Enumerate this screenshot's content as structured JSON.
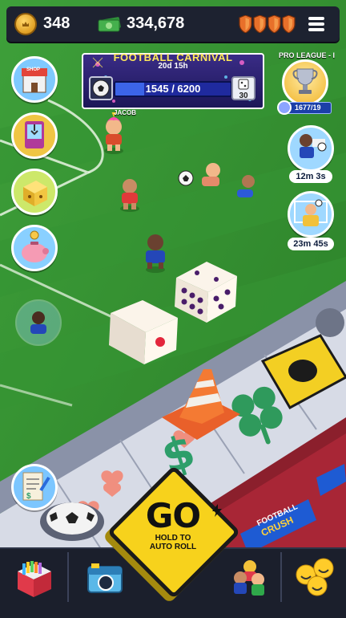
{
  "topbar": {
    "coins": "348",
    "cash": "334,678",
    "shields": 4
  },
  "event": {
    "title": "FOOTBALL CARNIVAL",
    "timer": "20d 15h",
    "progress_text": "1545 / 6200",
    "progress_fraction": 0.249,
    "dice_count": "30"
  },
  "league": {
    "title": "PRO LEAGUE - I",
    "progress_text": "1677/19"
  },
  "side_left": {
    "shop_label": "SHOP"
  },
  "side_right": {
    "timer_1": "12m 3s",
    "timer_2": "23m 45s"
  },
  "players": {
    "name_tag": "JACOB"
  },
  "board": {
    "brand_top": "FOOTBALL",
    "brand_bottom": "CRUSH"
  },
  "go_button": {
    "label": "GO",
    "subtitle_line1": "HOLD TO",
    "subtitle_line2": "AUTO ROLL"
  },
  "colors": {
    "pitch": "#2f8a2a",
    "accent_yellow": "#f7d21c",
    "bar_dark": "#1d2230",
    "shield_orange": "#e8702a"
  }
}
